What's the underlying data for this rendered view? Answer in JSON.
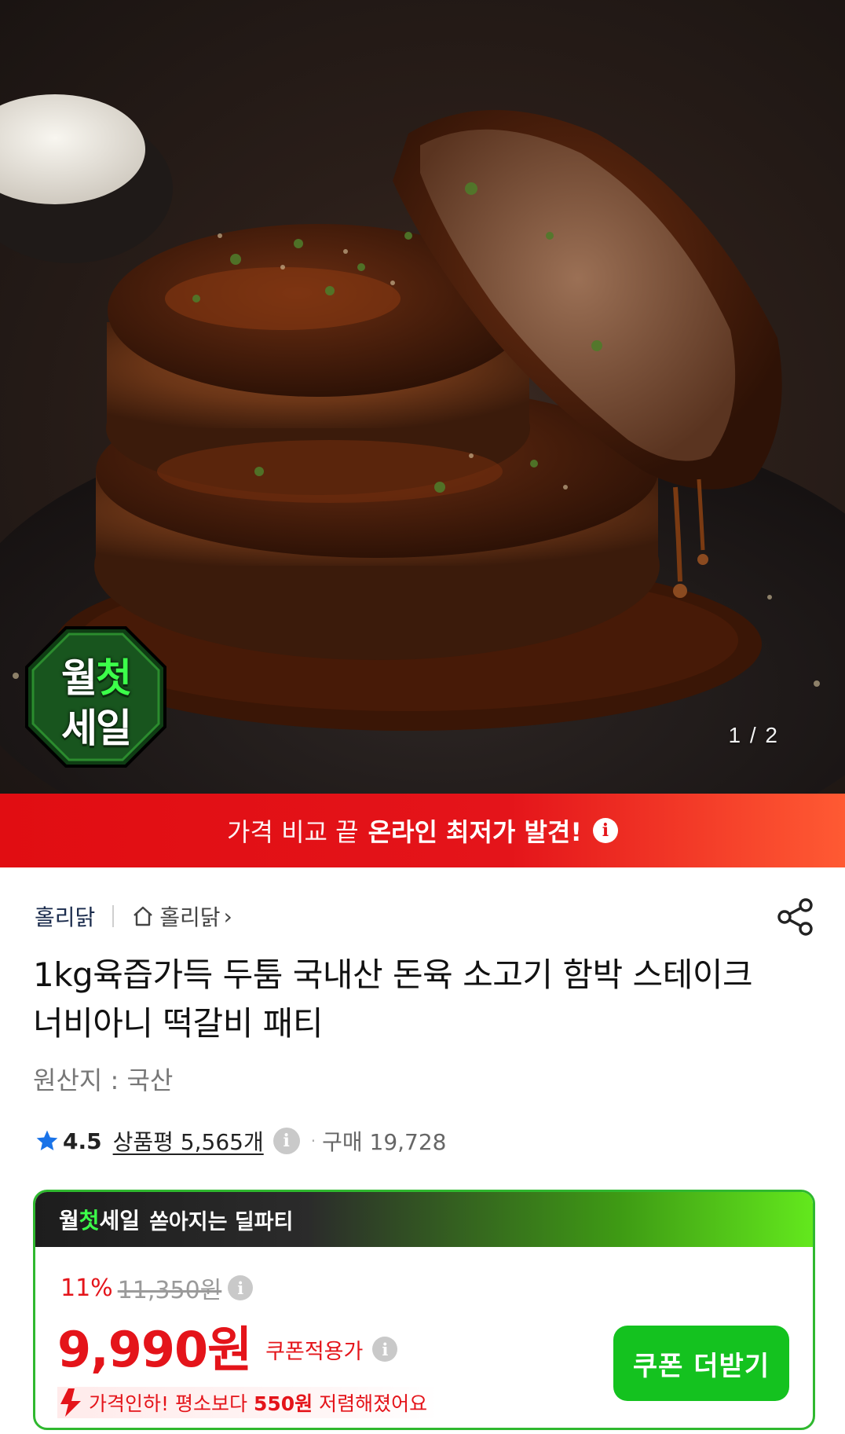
{
  "hero": {
    "page_indicator": "1 / 2",
    "badge_line1_a": "월",
    "badge_line1_b": "첫",
    "badge_line2": "세일"
  },
  "banner": {
    "text_light": "가격 비교 끝",
    "text_bold": "온라인 최저가 발견!",
    "info_icon": "i"
  },
  "product": {
    "seller": "홀리닭",
    "store_link": "홀리닭",
    "store_chevron": "›",
    "title": "1kg육즙가득 두툼 국내산 돈육 소고기 함박 스테이크 너비아니 떡갈비 패티",
    "origin": "원산지 : 국산",
    "rating": "4.5",
    "reviews": "상품평 5,565개",
    "purchase_count": "구매 19,728"
  },
  "deal": {
    "header_a": "월",
    "header_b": "첫",
    "header_c": "세일",
    "header_sub": "쏟아지는 딜파티",
    "discount_pct": "11%",
    "original_price": "11,350원",
    "price": "9,990원",
    "coupon_label": "쿠폰적용가",
    "drop_prefix": "가격인하! 평소보다",
    "drop_amount": "550원",
    "drop_suffix": "저렴해졌어요",
    "coupon_button": "쿠폰 더받기"
  },
  "colors": {
    "accent_red": "#e4141a",
    "accent_green": "#14c21f",
    "star_blue": "#1a73e8"
  },
  "icons": [
    "home-icon",
    "share-icon",
    "star-icon",
    "info-icon",
    "price-down-arrow-icon"
  ]
}
